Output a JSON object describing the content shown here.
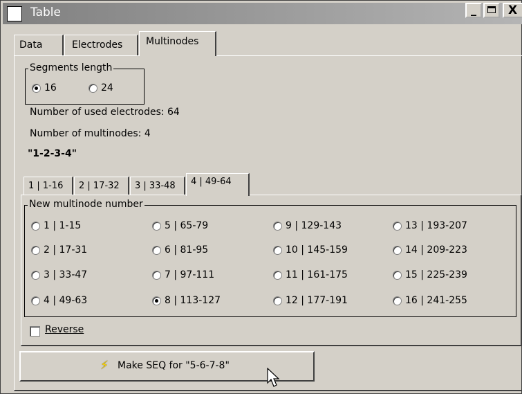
{
  "window": {
    "title": "Table",
    "minimize": "_",
    "maximize": "□",
    "close": "X"
  },
  "tabs": [
    {
      "label": "Data"
    },
    {
      "label": "Electrodes"
    },
    {
      "label": "Multinodes",
      "selected": true
    }
  ],
  "segments": {
    "legend": "Segments length",
    "options": [
      {
        "label": "16",
        "selected": true
      },
      {
        "label": "24",
        "selected": false
      }
    ]
  },
  "info": {
    "used_electrodes": "Number of used electrodes: 64",
    "multinodes": "Number of multinodes: 4",
    "sequence": "\"1-2-3-4\""
  },
  "subtabs": [
    {
      "label": "1 | 1-16"
    },
    {
      "label": "2 | 17-32"
    },
    {
      "label": "3 | 33-48"
    },
    {
      "label": "4 | 49-64",
      "selected": true
    }
  ],
  "multinode_group": {
    "legend": "New multinode number",
    "options": [
      {
        "label": "1 | 1-15",
        "selected": false
      },
      {
        "label": "5 | 65-79",
        "selected": false
      },
      {
        "label": "9 | 129-143",
        "selected": false
      },
      {
        "label": "13 | 193-207",
        "selected": false
      },
      {
        "label": "2 | 17-31",
        "selected": false
      },
      {
        "label": "6 | 81-95",
        "selected": false
      },
      {
        "label": "10 | 145-159",
        "selected": false
      },
      {
        "label": "14 | 209-223",
        "selected": false
      },
      {
        "label": "3 | 33-47",
        "selected": false
      },
      {
        "label": "7 | 97-111",
        "selected": false
      },
      {
        "label": "11 | 161-175",
        "selected": false
      },
      {
        "label": "15 | 225-239",
        "selected": false
      },
      {
        "label": "4 | 49-63",
        "selected": false
      },
      {
        "label": "8 | 113-127",
        "selected": true
      },
      {
        "label": "12 | 177-191",
        "selected": false
      },
      {
        "label": "16 | 241-255",
        "selected": false
      }
    ]
  },
  "reverse": {
    "label": "Reverse",
    "checked": false
  },
  "make_button": {
    "label": "Make SEQ for \"5-6-7-8\"",
    "icon": "lightning-icon"
  }
}
